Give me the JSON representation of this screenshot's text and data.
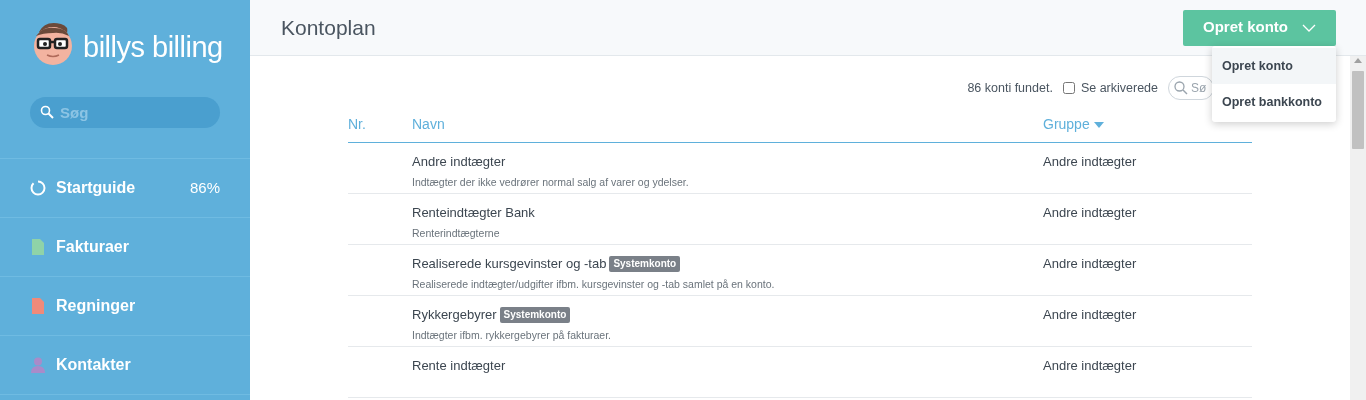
{
  "sidebar": {
    "logo": "billys billing",
    "search": {
      "placeholder": "Søg"
    },
    "items": [
      {
        "label": "Startguide",
        "kind": "progress",
        "value": "86%"
      },
      {
        "label": "Fakturaer",
        "kind": "invoice",
        "color": "#8fd3a8"
      },
      {
        "label": "Regninger",
        "kind": "bill",
        "color": "#f08a7a"
      },
      {
        "label": "Kontakter",
        "kind": "contact",
        "color": "#a98bc9"
      }
    ]
  },
  "header": {
    "title": "Kontoplan",
    "button": "Opret konto",
    "menu": [
      {
        "label": "Opret konto",
        "selected": true
      },
      {
        "label": "Opret bankkonto",
        "selected": false
      }
    ]
  },
  "toolbar": {
    "count": "86 konti fundet.",
    "archived": {
      "label": "Se arkiverede",
      "checked": false
    },
    "search": {
      "placeholder": "Sø"
    }
  },
  "table": {
    "columns": [
      "Nr.",
      "Navn",
      "Gruppe"
    ],
    "rows": [
      {
        "name": "Andre indtægter",
        "description": "Indtægter der ikke vedrører normal salg af varer og ydelser.",
        "group": "Andre indtægter"
      },
      {
        "name": "Renteindtægter Bank",
        "description": "Renterindtægterne",
        "group": "Andre indtægter"
      },
      {
        "name": "Realiserede kursgevinster og -tab",
        "badge": "Systemkonto",
        "description": "Realiserede indtægter/udgifter ifbm. kursgevinster og -tab samlet på en konto.",
        "group": "Andre indtægter"
      },
      {
        "name": "Rykkergebyrer",
        "badge": "Systemkonto",
        "description": "Indtægter ifbm. rykkergebyrer på fakturaer.",
        "group": "Andre indtægter"
      },
      {
        "name": "Rente indtægter",
        "group": "Andre indtægter"
      }
    ]
  }
}
